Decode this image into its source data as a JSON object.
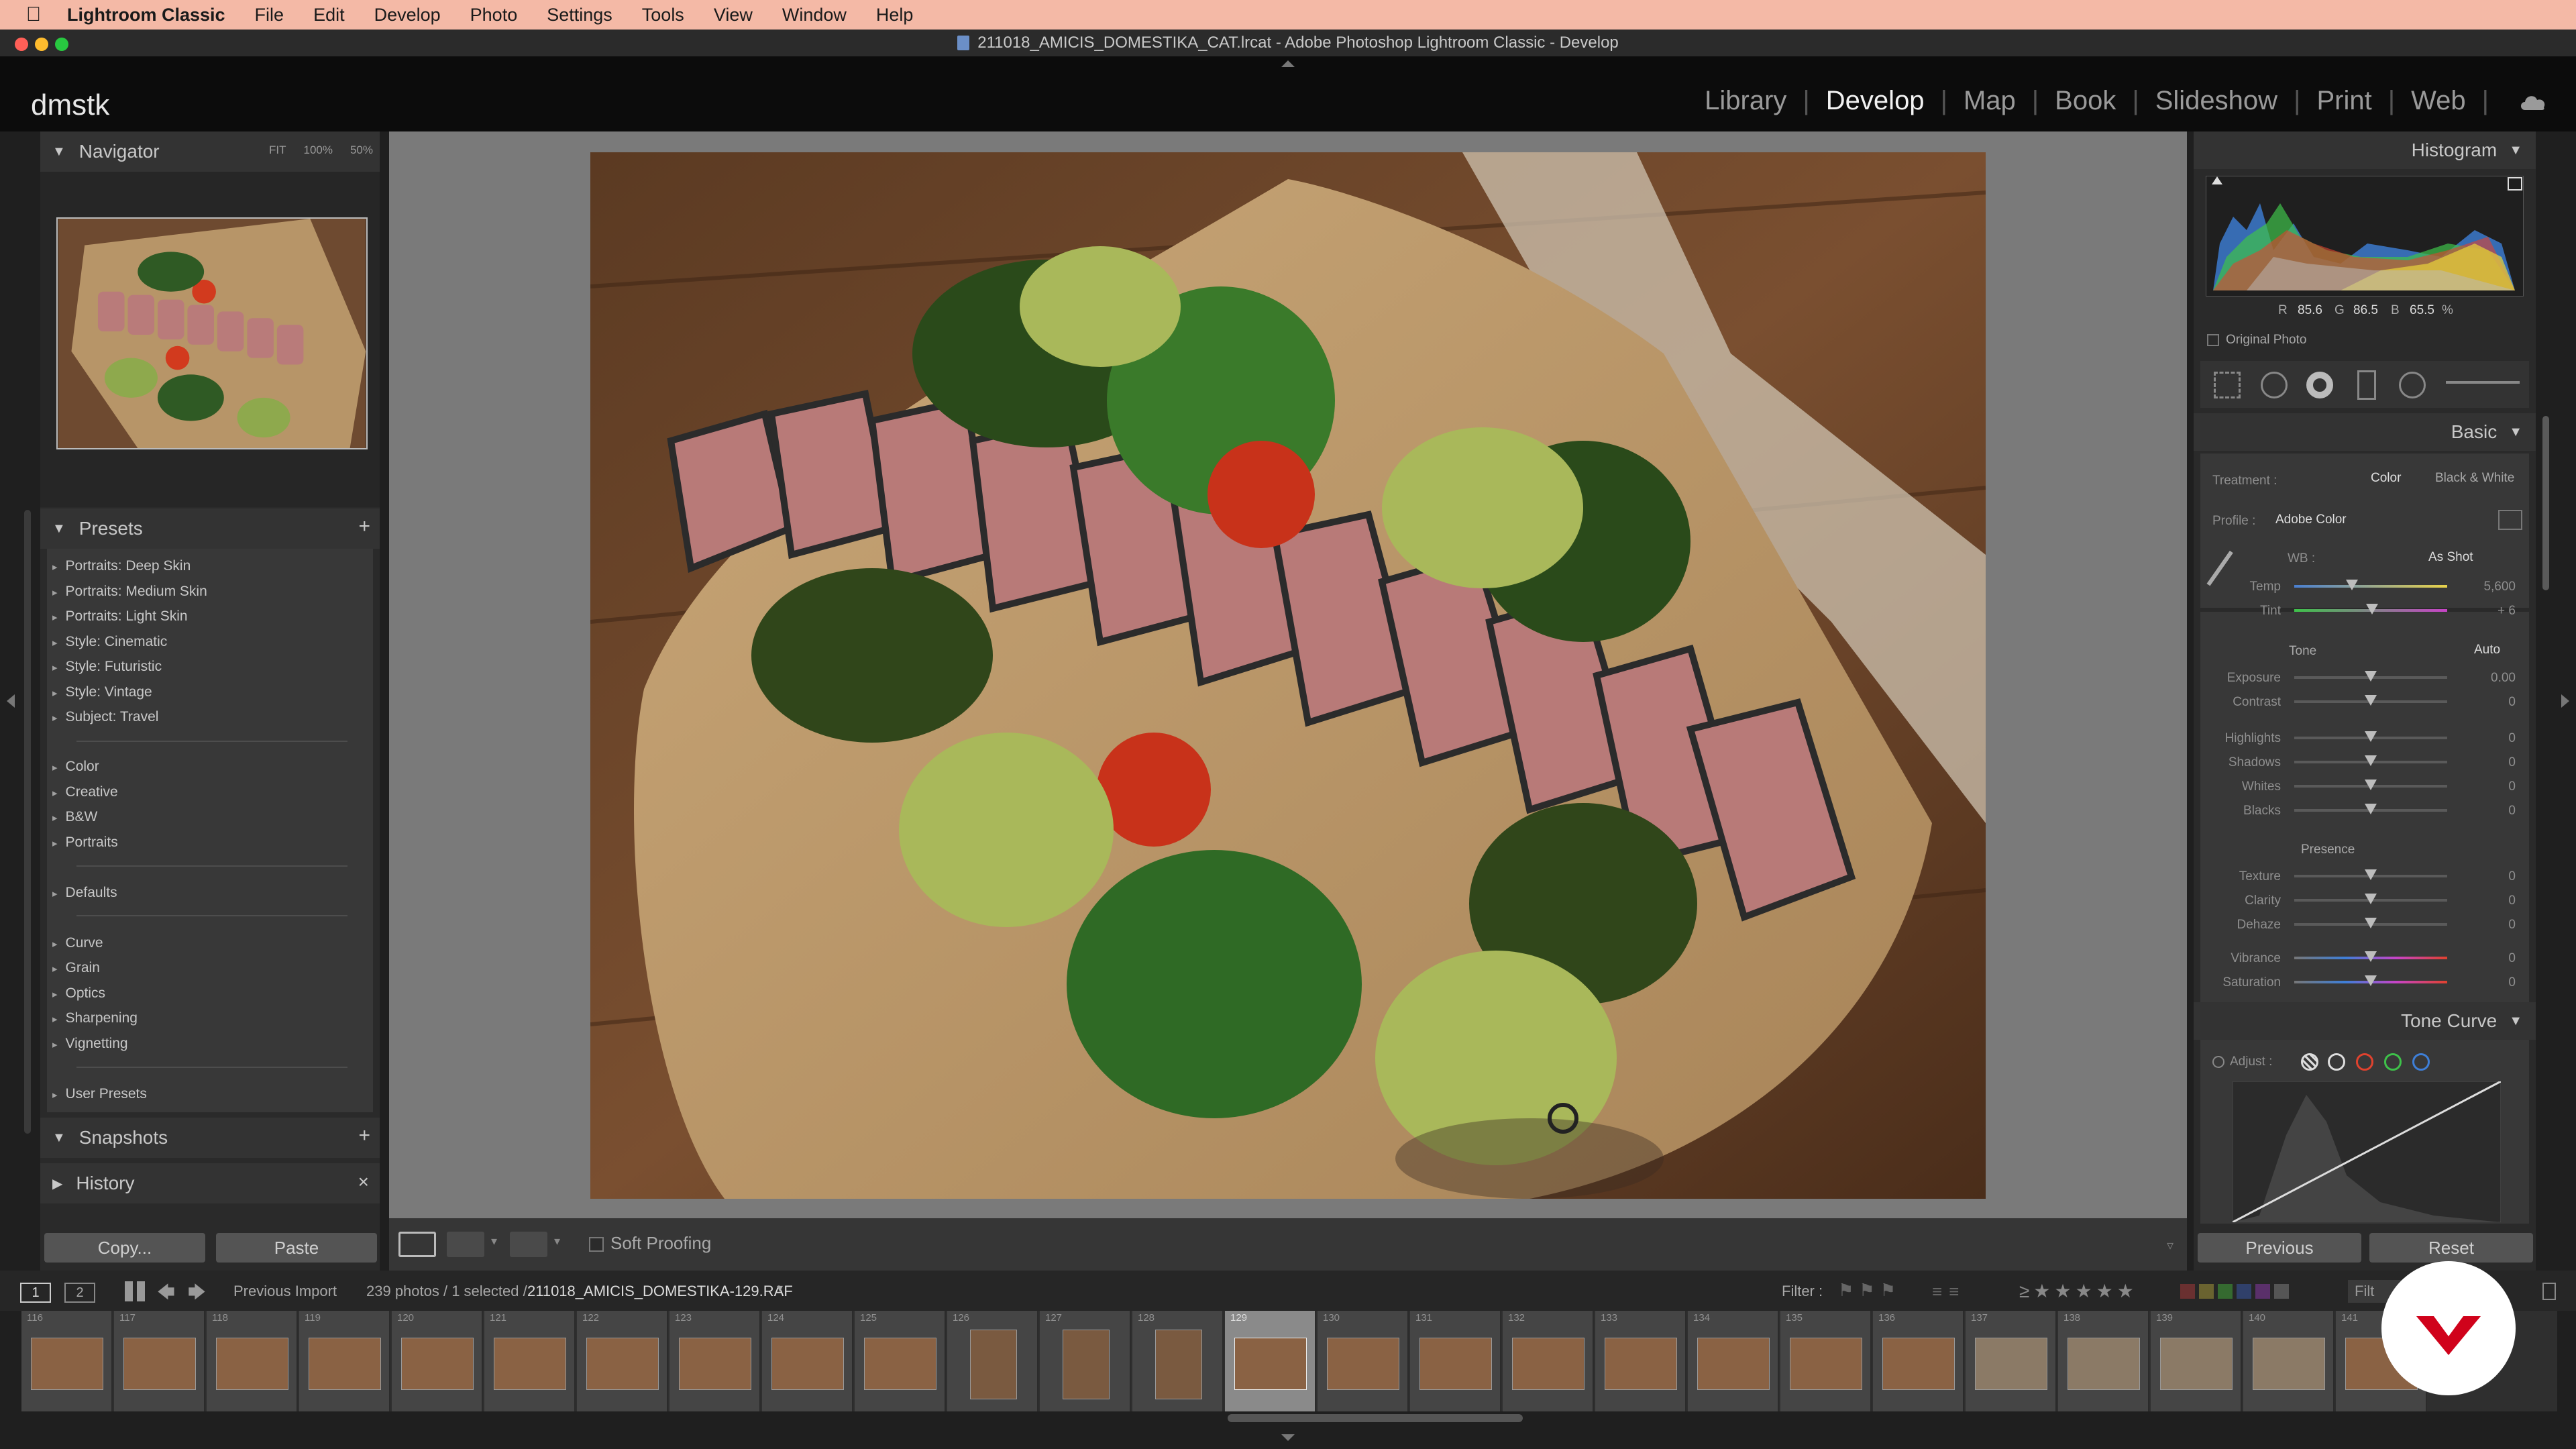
{
  "menubar": {
    "app_name": "Lightroom Classic",
    "items": [
      "File",
      "Edit",
      "Develop",
      "Photo",
      "Settings",
      "Tools",
      "View",
      "Window",
      "Help"
    ]
  },
  "window": {
    "title": "211018_AMICIS_DOMESTIKA_CAT.lrcat - Adobe Photoshop Lightroom Classic - Develop"
  },
  "identity_plate": "dmstk",
  "modules": [
    {
      "label": "Library",
      "active": false
    },
    {
      "label": "Develop",
      "active": true
    },
    {
      "label": "Map",
      "active": false
    },
    {
      "label": "Book",
      "active": false
    },
    {
      "label": "Slideshow",
      "active": false
    },
    {
      "label": "Print",
      "active": false
    },
    {
      "label": "Web",
      "active": false
    }
  ],
  "navigator": {
    "title": "Navigator",
    "zoom": [
      "FIT",
      "100%",
      "50%"
    ]
  },
  "presets": {
    "title": "Presets",
    "add": "+",
    "groups": [
      [
        "Portraits: Deep Skin",
        "Portraits: Medium Skin",
        "Portraits: Light Skin",
        "Style: Cinematic",
        "Style: Futuristic",
        "Style: Vintage",
        "Subject: Travel"
      ],
      [
        "Color",
        "Creative",
        "B&W",
        "Portraits"
      ],
      [
        "Defaults"
      ],
      [
        "Curve",
        "Grain",
        "Optics",
        "Sharpening",
        "Vignetting"
      ],
      [
        "User Presets"
      ]
    ]
  },
  "snapshots": {
    "title": "Snapshots",
    "add": "+"
  },
  "history": {
    "title": "History",
    "clear": "×"
  },
  "left_buttons": {
    "copy": "Copy...",
    "paste": "Paste"
  },
  "toolbar": {
    "soft_proofing": "Soft Proofing"
  },
  "histogram": {
    "title": "Histogram",
    "r_label": "R",
    "r": "85.6",
    "g_label": "G",
    "g": "86.5",
    "b_label": "B",
    "b": "65.5",
    "unit": "%",
    "original_photo": "Original Photo"
  },
  "basic": {
    "title": "Basic",
    "treatment_label": "Treatment :",
    "treatment_color": "Color",
    "treatment_bw": "Black & White",
    "profile_label": "Profile :",
    "profile_value": "Adobe Color",
    "wb_label": "WB :",
    "wb_value": "As Shot",
    "temp": {
      "label": "Temp",
      "value": "5,600"
    },
    "tint": {
      "label": "Tint",
      "value": "+ 6"
    },
    "tone_label": "Tone",
    "auto": "Auto",
    "tone": [
      {
        "label": "Exposure",
        "value": "0.00"
      },
      {
        "label": "Contrast",
        "value": "0"
      },
      {
        "label": "Highlights",
        "value": "0"
      },
      {
        "label": "Shadows",
        "value": "0"
      },
      {
        "label": "Whites",
        "value": "0"
      },
      {
        "label": "Blacks",
        "value": "0"
      }
    ],
    "presence_label": "Presence",
    "presence": [
      {
        "label": "Texture",
        "value": "0"
      },
      {
        "label": "Clarity",
        "value": "0"
      },
      {
        "label": "Dehaze",
        "value": "0"
      },
      {
        "label": "Vibrance",
        "value": "0"
      },
      {
        "label": "Saturation",
        "value": "0"
      }
    ]
  },
  "tone_curve": {
    "title": "Tone Curve",
    "adjust_label": "Adjust :"
  },
  "right_buttons": {
    "previous": "Previous",
    "reset": "Reset"
  },
  "filmstrip_bar": {
    "page1": "1",
    "page2": "2",
    "source": "Previous Import",
    "count": "239 photos / 1 selected /",
    "filename": "211018_AMICIS_DOMESTIKA-129.RAF",
    "filter_label": "Filter :",
    "filter_partial": "Filt"
  },
  "filmstrip": {
    "numbers": [
      "116",
      "117",
      "118",
      "119",
      "120",
      "121",
      "122",
      "123",
      "124",
      "125",
      "126",
      "127",
      "128",
      "129",
      "130",
      "131",
      "132",
      "133",
      "134",
      "135",
      "136",
      "137",
      "138",
      "139",
      "140",
      "141"
    ],
    "selected_index": 13
  },
  "colors": {
    "menubar": "#f4b9a6",
    "panel": "#2f2f2f",
    "canvas": "#7a7a7a",
    "brand_red": "#d0021b"
  }
}
